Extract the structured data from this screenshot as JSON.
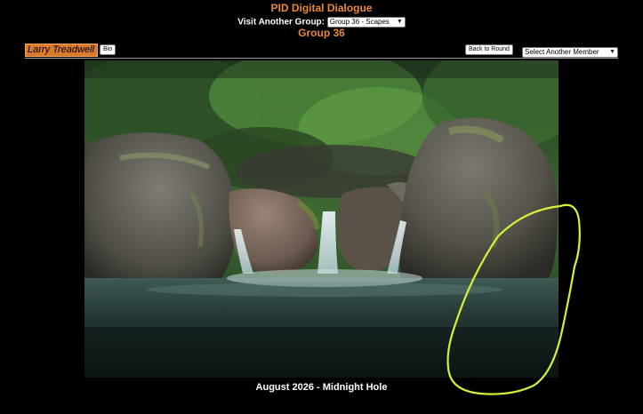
{
  "header": {
    "site_title": "PID Digital Dialogue",
    "visit_label": "Visit Another Group:",
    "group_select_value": "Group 36 - Scapes",
    "group_heading": "Group 36"
  },
  "member": {
    "name": "Larry Treadwell",
    "bio_label": "Bio",
    "back_label": "Back to Round",
    "select_member_image_value": "Select Another Member Image"
  },
  "image": {
    "caption": "August 2026 - Midnight Hole"
  },
  "colors": {
    "accent_orange": "#e8873a",
    "annotation_green": "#d6f03a",
    "background": "#000000"
  },
  "icons": {
    "dropdown": "chevron-down-icon"
  }
}
